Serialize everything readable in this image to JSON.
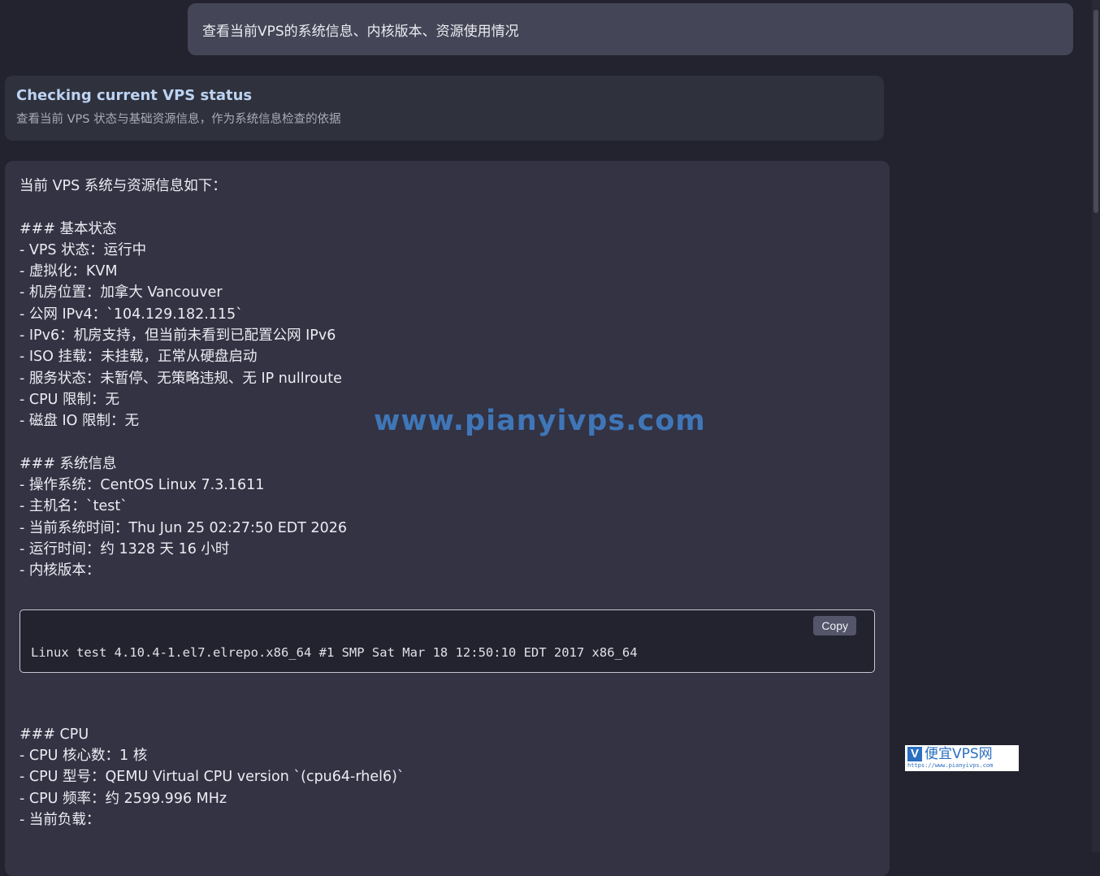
{
  "user_message": "查看当前VPS的系统信息、内核版本、资源使用情况",
  "status_card": {
    "title": "Checking current VPS status",
    "subtitle": "查看当前 VPS 状态与基础资源信息，作为系统信息检查的依据"
  },
  "reply": {
    "lines_before_code": [
      "当前 VPS 系统与资源信息如下：",
      "",
      "### 基本状态",
      "- VPS 状态：运行中",
      "- 虚拟化：KVM",
      "- 机房位置：加拿大 Vancouver",
      "- 公网 IPv4：`104.129.182.115`",
      "- IPv6：机房支持，但当前未看到已配置公网 IPv6",
      "- ISO 挂载：未挂载，正常从硬盘启动",
      "- 服务状态：未暂停、无策略违规、无 IP nullroute",
      "- CPU 限制：无",
      "- 磁盘 IO 限制：无",
      "",
      "### 系统信息",
      "- 操作系统：CentOS Linux 7.3.1611",
      "- 主机名：`test`",
      "- 当前系统时间：Thu Jun 25 02:27:50 EDT 2026",
      "- 运行时间：约 1328 天 16 小时",
      "- 内核版本："
    ],
    "code_block": {
      "copy_label": "Copy",
      "text": "Linux test 4.10.4-1.el7.elrepo.x86_64 #1 SMP Sat Mar 18 12:50:10 EDT 2017 x86_64"
    },
    "lines_after_code": [
      "### CPU",
      "- CPU 核心数：1 核",
      "- CPU 型号：QEMU Virtual CPU version `(cpu64-rhel6)`",
      "- CPU 频率：约 2599.996 MHz",
      "- 当前负载："
    ]
  },
  "watermark": "www.pianyivps.com",
  "logo": {
    "mark": "V",
    "name": "便宜VPS网",
    "url": "https://www.pianyivps.com"
  }
}
